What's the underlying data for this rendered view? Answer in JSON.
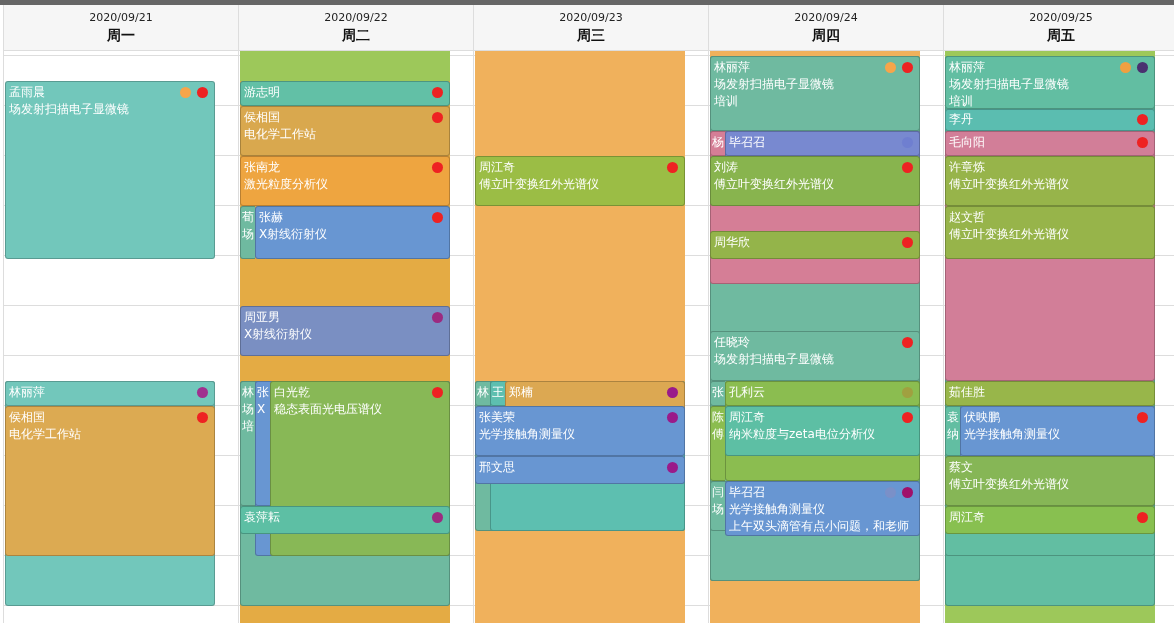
{
  "days": [
    {
      "date": "2020/09/21",
      "weekday": "周一",
      "events": [
        {
          "kind": "event",
          "name": "孟雨晨",
          "color": "#72c7bb",
          "lines": [
            "场发射扫描电子显微镜"
          ],
          "dots": [
            {
              "color": "#f7a54a"
            },
            {
              "color": "#ee2222"
            }
          ]
        },
        {
          "kind": "event",
          "name": "林丽萍",
          "color": "#72c7bb",
          "dots": [
            {
              "color": "#a0308f"
            }
          ]
        },
        {
          "kind": "event",
          "name": "侯相国",
          "color": "#dcaa52",
          "lines": [
            "电化学工作站"
          ],
          "dots": [
            {
              "color": "#ee2222"
            }
          ]
        }
      ]
    },
    {
      "date": "2020/09/22",
      "weekday": "周二",
      "events": [
        {
          "kind": "block",
          "color": "#e4ab44"
        },
        {
          "kind": "block",
          "color": "#9dc85a"
        },
        {
          "kind": "event",
          "name": "游志明",
          "color": "#62c0a6",
          "dots": [
            {
              "color": "#ee2222"
            }
          ]
        },
        {
          "kind": "event",
          "name": "侯相国",
          "color": "#d9a84e",
          "lines": [
            "电化学工作站"
          ],
          "dots": [
            {
              "color": "#ee2222"
            }
          ]
        },
        {
          "kind": "event",
          "name": "张南龙",
          "color": "#eea540",
          "lines": [
            "激光粒度分析仪"
          ],
          "dots": [
            {
              "color": "#ee2222"
            }
          ]
        },
        {
          "kind": "event",
          "name": "荀",
          "color": "#6fbaa0",
          "lines": [
            "场"
          ]
        },
        {
          "kind": "event",
          "name": "张赫",
          "color": "#6896d2",
          "lines": [
            "X射线衍射仪"
          ],
          "dots": [
            {
              "color": "#ee2222"
            }
          ]
        },
        {
          "kind": "event",
          "name": "周亚男",
          "color": "#7a8fc2",
          "lines": [
            "X射线衍射仪"
          ],
          "dots": [
            {
              "color": "#9c2a80"
            }
          ]
        },
        {
          "kind": "event",
          "name": "林",
          "color": "#6fbaa0",
          "lines": [
            "场",
            "培"
          ]
        },
        {
          "kind": "event",
          "name": "张",
          "color": "#6896d2",
          "lines": [
            "X"
          ]
        },
        {
          "kind": "event",
          "name": "白光乾",
          "color": "#88b856",
          "lines": [
            "稳态表面光电压谱仪"
          ],
          "dots": [
            {
              "color": "#ee2222"
            }
          ]
        },
        {
          "kind": "event",
          "name": "袁萍耘",
          "color": "#5dbfa4",
          "dots": [
            {
              "color": "#9c2a80"
            }
          ]
        }
      ]
    },
    {
      "date": "2020/09/23",
      "weekday": "周三",
      "events": [
        {
          "kind": "block",
          "color": "#f0b15c"
        },
        {
          "kind": "event",
          "name": "周江奇",
          "color": "#9bbd45",
          "lines": [
            "傅立叶变换红外光谱仪"
          ],
          "dots": [
            {
              "color": "#ee2222"
            }
          ]
        },
        {
          "kind": "event",
          "name": "林",
          "color": "#6fbaa0"
        },
        {
          "kind": "event",
          "name": "王",
          "color": "#5dbfb0"
        },
        {
          "kind": "event",
          "name": "郑楠",
          "color": "#dca852",
          "dots": [
            {
              "color": "#9a1a8a"
            }
          ]
        },
        {
          "kind": "event",
          "name": "张美荣",
          "color": "#6896d2",
          "lines": [
            "光学接触角测量仪"
          ],
          "dots": [
            {
              "color": "#9a1a8a"
            }
          ]
        },
        {
          "kind": "event",
          "name": "邢文思",
          "color": "#6896d2",
          "dots": [
            {
              "color": "#9a1a8a"
            }
          ]
        }
      ]
    },
    {
      "date": "2020/09/24",
      "weekday": "周四",
      "events": [
        {
          "kind": "block",
          "color": "#f0b15c"
        },
        {
          "kind": "event",
          "name": "林丽萍",
          "color": "#6fbaa0",
          "lines": [
            "场发射扫描电子显微镜",
            "培训"
          ],
          "dots": [
            {
              "color": "#f7a54a"
            },
            {
              "color": "#ee2222"
            }
          ]
        },
        {
          "kind": "event",
          "name": "杨",
          "color": "#d57e96"
        },
        {
          "kind": "event",
          "name": "毕召召",
          "color": "#7889d0",
          "dots": [
            {
              "color": "#6f7fd0"
            }
          ]
        },
        {
          "kind": "event",
          "name": "刘涛",
          "color": "#88b44e",
          "lines": [
            "傅立叶变换红外光谱仪"
          ],
          "dots": [
            {
              "color": "#ee2222"
            }
          ]
        },
        {
          "kind": "event",
          "name": "周华欣",
          "color": "#94b44a",
          "dots": [
            {
              "color": "#ee2222"
            }
          ]
        },
        {
          "kind": "event",
          "name": "任晓玲",
          "color": "#6fbaa0",
          "lines": [
            "场发射扫描电子显微镜"
          ],
          "dots": [
            {
              "color": "#ee2222"
            }
          ]
        },
        {
          "kind": "event",
          "name": "张",
          "color": "#6fbaa0"
        },
        {
          "kind": "event",
          "name": "孔利云",
          "color": "#8bbd50",
          "dots": [
            {
              "color": "#a0a040"
            }
          ]
        },
        {
          "kind": "event",
          "name": "陈",
          "color": "#8bbd50",
          "lines": [
            "傅"
          ]
        },
        {
          "kind": "event",
          "name": "周江奇",
          "color": "#5dbfa4",
          "lines": [
            "纳米粒度与zeta电位分析仪"
          ],
          "dots": [
            {
              "color": "#ee2222"
            }
          ]
        },
        {
          "kind": "event",
          "name": "闫",
          "color": "#6fbaa0",
          "lines": [
            "场"
          ]
        },
        {
          "kind": "event",
          "name": "毕召召",
          "color": "#6896d2",
          "lines": [
            "光学接触角测量仪",
            "上午双头滴管有点小问题，和老师"
          ],
          "dots": [
            {
              "color": "#7a90c8"
            },
            {
              "color": "#a0106a"
            }
          ]
        }
      ]
    },
    {
      "date": "2020/09/25",
      "weekday": "周五",
      "events": [
        {
          "kind": "block",
          "color": "#9dc85a"
        },
        {
          "kind": "event",
          "name": "林丽萍",
          "color": "#62bea2",
          "lines": [
            "场发射扫描电子显微镜",
            "培训"
          ],
          "dots": [
            {
              "color": "#f0a040"
            },
            {
              "color": "#4a3070"
            }
          ]
        },
        {
          "kind": "event",
          "name": "李丹",
          "color": "#5bbdb0",
          "dots": [
            {
              "color": "#ee2222"
            }
          ]
        },
        {
          "kind": "event",
          "name": "毛向阳",
          "color": "#d27e98",
          "dots": [
            {
              "color": "#ee2222"
            }
          ]
        },
        {
          "kind": "event",
          "name": "许章炼",
          "color": "#97b44a",
          "lines": [
            "傅立叶变换红外光谱仪"
          ]
        },
        {
          "kind": "event",
          "name": "赵文哲",
          "color": "#97b44a",
          "lines": [
            "傅立叶变换红外光谱仪"
          ]
        },
        {
          "kind": "event",
          "name": "茹佳胜",
          "color": "#98b64a"
        },
        {
          "kind": "event",
          "name": "袁",
          "color": "#62bea2",
          "lines": [
            "纳"
          ]
        },
        {
          "kind": "event",
          "name": "伏映鹏",
          "color": "#6896d2",
          "lines": [
            "光学接触角测量仪"
          ],
          "dots": [
            {
              "color": "#ee2222"
            }
          ]
        },
        {
          "kind": "event",
          "name": "蔡文",
          "color": "#86b656",
          "lines": [
            "傅立叶变换红外光谱仪"
          ]
        },
        {
          "kind": "event",
          "name": "周江奇",
          "color": "#88c050",
          "dots": [
            {
              "color": "#ee2222"
            }
          ]
        }
      ]
    }
  ]
}
